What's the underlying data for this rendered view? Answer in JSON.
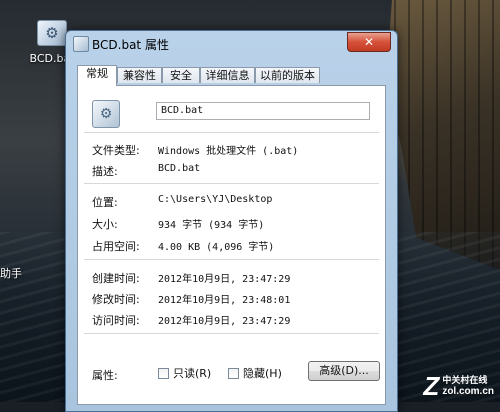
{
  "desktop": {
    "icon_label": "BCD.bat",
    "side_text": "助手",
    "watermark": {
      "logo": "Z",
      "line1": "中关村在线",
      "line2": "zol.com.cn"
    }
  },
  "window": {
    "title": "BCD.bat 属性",
    "close_glyph": "✕",
    "tabs": [
      "常规",
      "兼容性",
      "安全",
      "详细信息",
      "以前的版本"
    ],
    "active_tab": "常规",
    "file_name": "BCD.bat",
    "fields": {
      "type": {
        "label": "文件类型:",
        "value": "Windows 批处理文件 (.bat)"
      },
      "desc": {
        "label": "描述:",
        "value": "BCD.bat"
      },
      "location": {
        "label": "位置:",
        "value": "C:\\Users\\YJ\\Desktop"
      },
      "size": {
        "label": "大小:",
        "value": "934 字节 (934 字节)"
      },
      "disk": {
        "label": "占用空间:",
        "value": "4.00 KB (4,096 字节)"
      },
      "created": {
        "label": "创建时间:",
        "value": "2012年10月9日, 23:47:29"
      },
      "modified": {
        "label": "修改时间:",
        "value": "2012年10月9日, 23:48:01"
      },
      "accessed": {
        "label": "访问时间:",
        "value": "2012年10月9日, 23:47:29"
      }
    },
    "attributes": {
      "label": "属性:",
      "readonly": {
        "label": "只读(R)",
        "checked": false
      },
      "hidden": {
        "label": "隐藏(H)",
        "checked": false
      },
      "advanced_button": "高级(D)..."
    }
  },
  "icons": [
    "bat-file-icon",
    "close-icon",
    "checkbox-icon"
  ]
}
